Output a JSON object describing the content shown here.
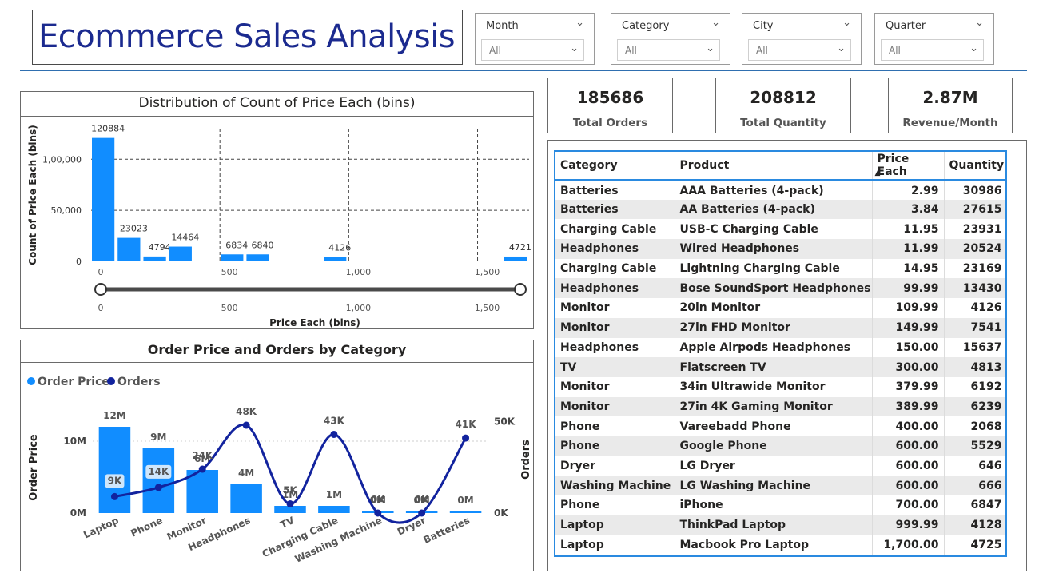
{
  "header": {
    "title": "Ecommerce Sales Analysis"
  },
  "slicers": [
    {
      "title": "Month",
      "value": "All"
    },
    {
      "title": "Category",
      "value": "All"
    },
    {
      "title": "City",
      "value": "All"
    },
    {
      "title": "Quarter",
      "value": "All"
    }
  ],
  "kpis": [
    {
      "value": "185686",
      "label": "Total Orders"
    },
    {
      "value": "208812",
      "label": "Total Quantity"
    },
    {
      "value": "2.87M",
      "label": "Revenue/Month"
    }
  ],
  "histogram": {
    "title": "Distribution of Count of Price Each (bins)",
    "slider_ticks": [
      "0",
      "500",
      "1,000",
      "1,500"
    ],
    "slider_range": [
      0,
      1700
    ]
  },
  "combo": {
    "title": "Order Price and Orders by Category",
    "legend": [
      {
        "name": "Order Price",
        "color": "#118dff"
      },
      {
        "name": "Orders",
        "color": "#12239e"
      }
    ]
  },
  "table": {
    "columns": [
      "Category",
      "Product",
      "Price Each",
      "Quantity"
    ],
    "sorted_column": "Price Each",
    "rows": [
      [
        "Batteries",
        "AAA Batteries (4-pack)",
        "2.99",
        "30986"
      ],
      [
        "Batteries",
        "AA Batteries (4-pack)",
        "3.84",
        "27615"
      ],
      [
        "Charging Cable",
        "USB-C Charging Cable",
        "11.95",
        "23931"
      ],
      [
        "Headphones",
        "Wired Headphones",
        "11.99",
        "20524"
      ],
      [
        "Charging Cable",
        "Lightning Charging Cable",
        "14.95",
        "23169"
      ],
      [
        "Headphones",
        "Bose SoundSport Headphones",
        "99.99",
        "13430"
      ],
      [
        "Monitor",
        "20in Monitor",
        "109.99",
        "4126"
      ],
      [
        "Monitor",
        "27in FHD Monitor",
        "149.99",
        "7541"
      ],
      [
        "Headphones",
        "Apple Airpods Headphones",
        "150.00",
        "15637"
      ],
      [
        "TV",
        "Flatscreen TV",
        "300.00",
        "4813"
      ],
      [
        "Monitor",
        "34in Ultrawide Monitor",
        "379.99",
        "6192"
      ],
      [
        "Monitor",
        "27in 4K Gaming Monitor",
        "389.99",
        "6239"
      ],
      [
        "Phone",
        "Vareebadd Phone",
        "400.00",
        "2068"
      ],
      [
        "Phone",
        "Google Phone",
        "600.00",
        "5529"
      ],
      [
        "Dryer",
        "LG Dryer",
        "600.00",
        "646"
      ],
      [
        "Washing Machine",
        "LG Washing Machine",
        "600.00",
        "666"
      ],
      [
        "Phone",
        "iPhone",
        "700.00",
        "6847"
      ],
      [
        "Laptop",
        "ThinkPad Laptop",
        "999.99",
        "4128"
      ],
      [
        "Laptop",
        "Macbook Pro Laptop",
        "1,700.00",
        "4725"
      ]
    ]
  },
  "chart_data": [
    {
      "type": "bar",
      "title": "Distribution of Count of Price Each (bins)",
      "xlabel": "Price Each (bins)",
      "ylabel": "Count of Price Each (bins)",
      "bin_width": 100,
      "x": [
        0,
        100,
        200,
        300,
        500,
        600,
        900,
        1600
      ],
      "values": [
        120884,
        23023,
        4794,
        14464,
        6834,
        6840,
        4126,
        4721
      ],
      "labels": [
        "120884",
        "23023",
        "4794",
        "14464",
        "6834",
        "6840",
        "4126",
        "4721"
      ],
      "xlim": [
        0,
        1700
      ],
      "ylim": [
        0,
        130000
      ],
      "x_ticks": [
        0,
        500,
        1000,
        1500
      ],
      "x_tick_labels": [
        "0",
        "500",
        "1,000",
        "1,500"
      ],
      "y_ticks": [
        0,
        50000,
        100000
      ],
      "y_tick_labels": [
        "0",
        "50,000",
        "1,00,000"
      ],
      "color": "#118dff",
      "grid": true
    },
    {
      "type": "bar",
      "title": "Order Price and Orders by Category",
      "categories": [
        "Laptop",
        "Phone",
        "Monitor",
        "Headphones",
        "TV",
        "Charging Cable",
        "Washing Machine",
        "Dryer",
        "Batteries"
      ],
      "series": [
        {
          "name": "Order Price",
          "type": "bar",
          "axis": "left",
          "values": [
            12000000,
            9000000,
            6000000,
            4000000,
            1000000,
            1000000,
            0,
            0,
            0
          ],
          "labels": [
            "12M",
            "9M",
            "6M",
            "4M",
            "1M",
            "1M",
            "0M",
            "0M",
            "0M"
          ],
          "color": "#118dff"
        },
        {
          "name": "Orders",
          "type": "line",
          "axis": "right",
          "values": [
            9000,
            14000,
            24000,
            48000,
            5000,
            43000,
            0,
            0,
            41000
          ],
          "labels": [
            "9K",
            "14K",
            "24K",
            "48K",
            "5K",
            "43K",
            "0K",
            "0K",
            "41K"
          ],
          "color": "#12239e"
        }
      ],
      "ylabel": "Order Price",
      "y2label": "Orders",
      "ylim": [
        0,
        14000000
      ],
      "y2lim": [
        0,
        55000
      ],
      "y_ticks": [
        0,
        10000000
      ],
      "y_tick_labels": [
        "0M",
        "10M"
      ],
      "y2_ticks": [
        0,
        50000
      ],
      "y2_tick_labels": [
        "0K",
        "50K"
      ],
      "legend": "top-left",
      "grid": true
    }
  ]
}
